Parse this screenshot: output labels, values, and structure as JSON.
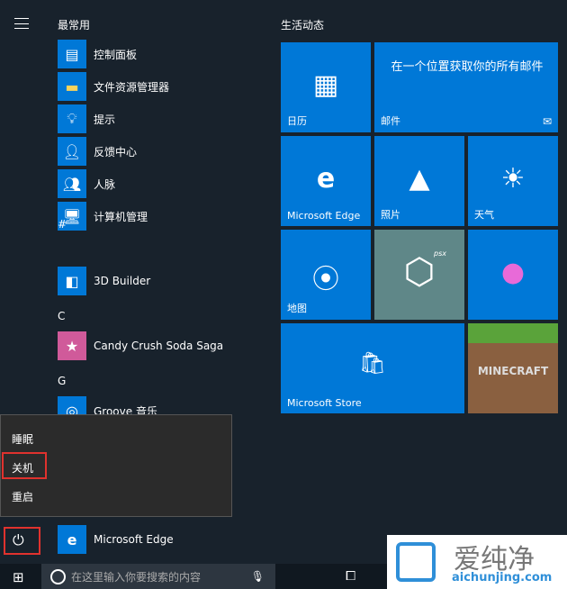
{
  "header": {
    "most_used": "最常用",
    "live_tiles": "生活动态"
  },
  "apps": [
    {
      "label": "控制面板",
      "icon": "control-panel-icon"
    },
    {
      "label": "文件资源管理器",
      "icon": "folder-icon"
    },
    {
      "label": "提示",
      "icon": "lightbulb-icon"
    },
    {
      "label": "反馈中心",
      "icon": "feedback-icon"
    },
    {
      "label": "人脉",
      "icon": "people-icon"
    },
    {
      "label": "计算机管理",
      "icon": "computer-management-icon"
    },
    {
      "label": "3D Builder",
      "icon": "3d-builder-icon"
    },
    {
      "label": "Candy Crush Soda Saga",
      "icon": "candy-crush-icon"
    },
    {
      "label": "Groove 音乐",
      "icon": "groove-icon"
    },
    {
      "label": "Microsoft Edge",
      "icon": "edge-icon"
    }
  ],
  "letters": [
    "#",
    "C",
    "G"
  ],
  "tiles": {
    "calendar": "日历",
    "mail": "邮件",
    "mail_text": "在一个位置获取你的所有邮件",
    "edge": "Microsoft Edge",
    "photos": "照片",
    "weather": "天气",
    "maps": "地图",
    "store": "Microsoft Store",
    "minecraft": "MINECRAFT",
    "psx": "psx"
  },
  "power_menu": {
    "sleep": "睡眠",
    "shutdown": "关机",
    "restart": "重启"
  },
  "taskbar": {
    "search_placeholder": "在这里输入你要搜索的内容"
  },
  "watermark": {
    "name": "爱纯净",
    "url": "aichunjing.com"
  },
  "colors": {
    "accent": "#0078d7",
    "highlight": "#e0322e"
  }
}
